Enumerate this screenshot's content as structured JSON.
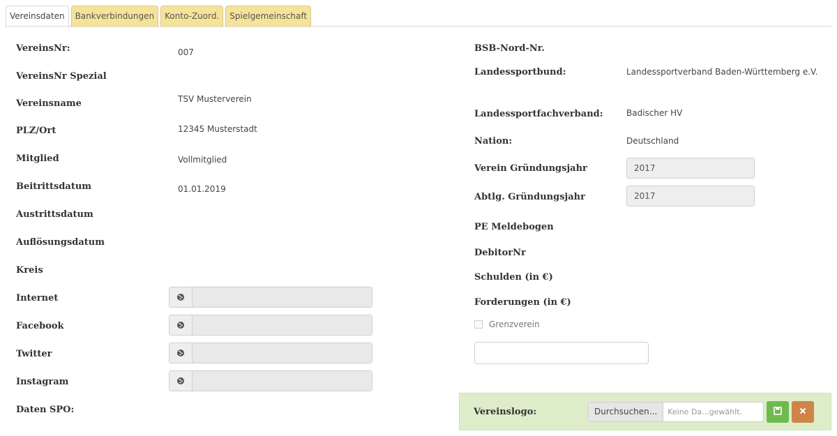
{
  "tabs": [
    "Vereinsdaten",
    "Bankverbindungen",
    "Konto-Zuord.",
    "Spielgemeinschaft"
  ],
  "left": {
    "vereinsnr_label": "VereinsNr:",
    "vereinsnr_value": "007",
    "vereinsnr_spezial_label": "VereinsNr Spezial",
    "vereinsname_label": "Vereinsname",
    "vereinsname_value": "TSV Musterverein",
    "plz_ort_label": "PLZ/Ort",
    "plz_ort_value": "12345 Musterstadt",
    "mitglied_label": "Mitglied",
    "mitglied_value": "Vollmitglied",
    "beitrittsdatum_label": "Beitrittsdatum",
    "beitrittsdatum_value": "01.01.2019",
    "austrittsdatum_label": "Austrittsdatum",
    "aufloesungsdatum_label": "Auflösungsdatum",
    "kreis_label": "Kreis",
    "internet_label": "Internet",
    "facebook_label": "Facebook",
    "twitter_label": "Twitter",
    "instagram_label": "Instagram",
    "daten_spo_label": "Daten SPO:"
  },
  "right": {
    "bsb_label": "BSB-Nord-Nr.",
    "landessportbund_label": "Landessportbund:",
    "landessportbund_value": "Landessportverband Baden-Württemberg e.V.",
    "landessportfachverband_label": "Landessportfachverband:",
    "landessportfachverband_value": "Badischer HV",
    "nation_label": "Nation:",
    "nation_value": "Deutschland",
    "verein_gruendungsjahr_label": "Verein Gründungsjahr",
    "verein_gruendungsjahr_value": "2017",
    "abtlg_gruendungsjahr_label": "Abtlg. Gründungsjahr",
    "abtlg_gruendungsjahr_value": "2017",
    "pe_meldebogen_label": "PE Meldebogen",
    "debitornr_label": "DebitorNr",
    "schulden_label": "Schulden (in €)",
    "forderungen_label": "Forderungen (in €)",
    "grenzverein_label": "Grenzverein"
  },
  "logo": {
    "label": "Vereinslogo:",
    "browse_label": "Durchsuchen...",
    "file_placeholder": "Keine Da...gewählt."
  },
  "colors": {
    "tab_inactive": "#f6e39a",
    "logo_bar": "#ddedc9",
    "save_button": "#6fba4f",
    "cancel_button": "#cf8448"
  },
  "icons": {
    "link_field": "globe-icon",
    "save": "save-icon",
    "cancel": "close-icon"
  }
}
